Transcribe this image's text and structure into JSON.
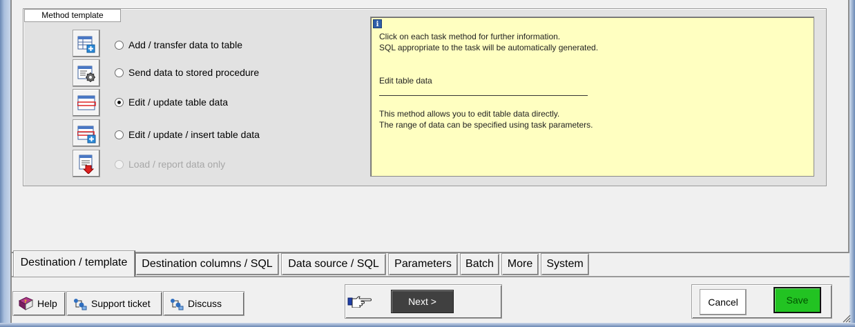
{
  "group": {
    "label": "Method template"
  },
  "methods": [
    {
      "label": "Add / transfer data to table",
      "checked": false,
      "enabled": true,
      "icon": "table-add-icon"
    },
    {
      "label": "Send data to stored procedure",
      "checked": false,
      "enabled": true,
      "icon": "procedure-gear-icon"
    },
    {
      "label": "Edit / update table data",
      "checked": true,
      "enabled": true,
      "icon": "table-edit-icon"
    },
    {
      "label": "Edit / update / insert table data",
      "checked": false,
      "enabled": true,
      "icon": "table-edit-insert-icon"
    },
    {
      "label": "Load / report data only",
      "checked": false,
      "enabled": false,
      "icon": "report-load-icon"
    }
  ],
  "info": {
    "icon_glyph": "i",
    "line1": "Click on each task method for further information.",
    "line2": "SQL appropriate to the task will be automatically generated.",
    "selected_title": "Edit table data",
    "desc1": "This method allows you to edit table data directly.",
    "desc2": "The range of data can be specified using task parameters."
  },
  "tabs": [
    {
      "label": "Destination / template",
      "active": true
    },
    {
      "label": "Destination columns / SQL",
      "active": false
    },
    {
      "label": "Data source / SQL",
      "active": false
    },
    {
      "label": "Parameters",
      "active": false
    },
    {
      "label": "Batch",
      "active": false
    },
    {
      "label": "More",
      "active": false
    },
    {
      "label": "System",
      "active": false
    }
  ],
  "buttons": {
    "help": "Help",
    "support": "Support ticket",
    "discuss": "Discuss",
    "next": "Next >",
    "cancel": "Cancel",
    "save": "Save"
  },
  "colors": {
    "info_bg": "#ffffc1",
    "save_bg": "#22c322",
    "next_bg": "#404040"
  }
}
